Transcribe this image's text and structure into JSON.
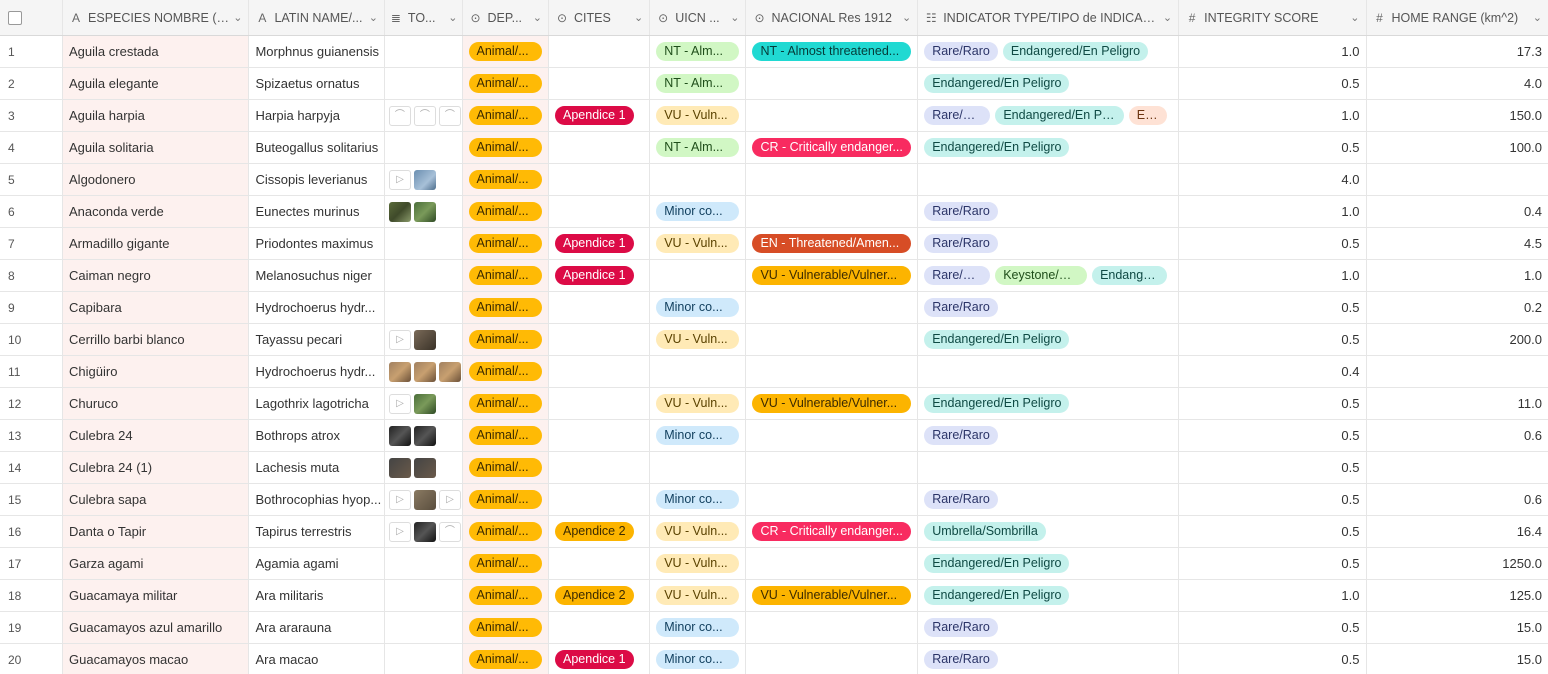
{
  "columns": [
    {
      "key": "name",
      "label": "ESPECIES NOMBRE (ES)",
      "icon": "A"
    },
    {
      "key": "latin",
      "label": "LATIN NAME/...",
      "icon": "A"
    },
    {
      "key": "to",
      "label": "TO...",
      "icon": "≣"
    },
    {
      "key": "dep",
      "label": "DEP...",
      "icon": "⊙"
    },
    {
      "key": "cites",
      "label": "CITES",
      "icon": "⊙"
    },
    {
      "key": "uicn",
      "label": "UICN ...",
      "icon": "⊙"
    },
    {
      "key": "nac",
      "label": "NACIONAL Res 1912",
      "icon": "⊙"
    },
    {
      "key": "ind",
      "label": "INDICATOR TYPE/TIPO de INDICACI...",
      "icon": "☷"
    },
    {
      "key": "int",
      "label": "INTEGRITY SCORE",
      "icon": "#"
    },
    {
      "key": "home",
      "label": "HOME RANGE (km^2)",
      "icon": "#"
    }
  ],
  "rows": [
    {
      "n": "1",
      "name": "Aguila crestada",
      "latin": "Morphnus guianensis",
      "to": [],
      "dep": "Animal/...",
      "cites": "",
      "uicn": {
        "t": "NT - Alm...",
        "c": "green"
      },
      "nac": {
        "t": "NT - Almost threatened...",
        "c": "teal"
      },
      "ind": [
        [
          "Rare/Raro",
          "lav"
        ],
        [
          "Endangered/En Peligro",
          "mint"
        ]
      ],
      "int": "1.0",
      "home": "17.3"
    },
    {
      "n": "2",
      "name": "Aguila elegante",
      "latin": "Spizaetus ornatus",
      "to": [],
      "dep": "Animal/...",
      "cites": "",
      "uicn": {
        "t": "NT - Alm...",
        "c": "green"
      },
      "nac": null,
      "ind": [
        [
          "Endangered/En Peligro",
          "mint"
        ]
      ],
      "int": "0.5",
      "home": "4.0"
    },
    {
      "n": "3",
      "name": "Aguila harpia",
      "latin": "Harpia harpyja",
      "to": [
        "doc",
        "doc",
        "doc"
      ],
      "dep": "Animal/...",
      "cites": "Apendice 1",
      "uicn": {
        "t": "VU - Vuln...",
        "c": "yellowl"
      },
      "nac": null,
      "ind": [
        [
          "Rare/Raro",
          "lav"
        ],
        [
          "Endangered/En Peligro",
          "mint"
        ],
        [
          "Emb",
          "peach"
        ]
      ],
      "int": "1.0",
      "home": "150.0"
    },
    {
      "n": "4",
      "name": "Aguila solitaria",
      "latin": "Buteogallus solitarius",
      "to": [],
      "dep": "Animal/...",
      "cites": "",
      "uicn": {
        "t": "NT - Alm...",
        "c": "green"
      },
      "nac": {
        "t": "CR - Critically endanger...",
        "c": "crimson"
      },
      "ind": [
        [
          "Endangered/En Peligro",
          "mint"
        ]
      ],
      "int": "0.5",
      "home": "100.0"
    },
    {
      "n": "5",
      "name": "Algodonero",
      "latin": "Cissopis leverianus",
      "to": [
        "play",
        "img2"
      ],
      "dep": "Animal/...",
      "cites": "",
      "uicn": null,
      "nac": null,
      "ind": [],
      "int": "4.0",
      "home": ""
    },
    {
      "n": "6",
      "name": "Anaconda verde",
      "latin": "Eunectes murinus",
      "to": [
        "img1",
        "img5"
      ],
      "dep": "Animal/...",
      "cites": "",
      "uicn": {
        "t": "Minor co...",
        "c": "blue"
      },
      "nac": null,
      "ind": [
        [
          "Rare/Raro",
          "lav"
        ]
      ],
      "int": "1.0",
      "home": "0.4"
    },
    {
      "n": "7",
      "name": "Armadillo gigante",
      "latin": "Priodontes maximus",
      "to": [],
      "dep": "Animal/...",
      "cites": "Apendice 1",
      "uicn": {
        "t": "VU - Vuln...",
        "c": "yellowl"
      },
      "nac": {
        "t": "EN - Threatened/Amen...",
        "c": "rust"
      },
      "ind": [
        [
          "Rare/Raro",
          "lav"
        ]
      ],
      "int": "0.5",
      "home": "4.5"
    },
    {
      "n": "8",
      "name": "Caiman negro",
      "latin": "Melanosuchus niger",
      "to": [],
      "dep": "Animal/...",
      "cites": "Apendice 1",
      "uicn": null,
      "nac": {
        "t": "VU - Vulnerable/Vulner...",
        "c": "amber"
      },
      "ind": [
        [
          "Rare/Raro",
          "lav"
        ],
        [
          "Keystone/Clave",
          "lime"
        ],
        [
          "Endangered",
          "mint"
        ]
      ],
      "int": "1.0",
      "home": "1.0"
    },
    {
      "n": "9",
      "name": "Capibara",
      "latin": "Hydrochoerus hydr...",
      "to": [],
      "dep": "Animal/...",
      "cites": "",
      "uicn": {
        "t": "Minor co...",
        "c": "blue"
      },
      "nac": null,
      "ind": [
        [
          "Rare/Raro",
          "lav"
        ]
      ],
      "int": "0.5",
      "home": "0.2"
    },
    {
      "n": "10",
      "name": "Cerrillo barbi blanco",
      "latin": "Tayassu pecari",
      "to": [
        "play",
        "img7"
      ],
      "dep": "Animal/...",
      "cites": "",
      "uicn": {
        "t": "VU - Vuln...",
        "c": "yellowl"
      },
      "nac": null,
      "ind": [
        [
          "Endangered/En Peligro",
          "mint"
        ]
      ],
      "int": "0.5",
      "home": "200.0"
    },
    {
      "n": "11",
      "name": "Chigüiro",
      "latin": "Hydrochoerus hydr...",
      "to": [
        "img4",
        "img4",
        "img4"
      ],
      "dep": "Animal/...",
      "cites": "",
      "uicn": null,
      "nac": null,
      "ind": [],
      "int": "0.4",
      "home": ""
    },
    {
      "n": "12",
      "name": "Churuco",
      "latin": "Lagothrix lagotricha",
      "to": [
        "play",
        "img5"
      ],
      "dep": "Animal/...",
      "cites": "",
      "uicn": {
        "t": "VU - Vuln...",
        "c": "yellowl"
      },
      "nac": {
        "t": "VU - Vulnerable/Vulner...",
        "c": "amber"
      },
      "ind": [
        [
          "Endangered/En Peligro",
          "mint"
        ]
      ],
      "int": "0.5",
      "home": "11.0"
    },
    {
      "n": "13",
      "name": "Culebra 24",
      "latin": "Bothrops atrox",
      "to": [
        "img6",
        "img6"
      ],
      "dep": "Animal/...",
      "cites": "",
      "uicn": {
        "t": "Minor co...",
        "c": "blue"
      },
      "nac": null,
      "ind": [
        [
          "Rare/Raro",
          "lav"
        ]
      ],
      "int": "0.5",
      "home": "0.6"
    },
    {
      "n": "14",
      "name": "Culebra 24 (1)",
      "latin": "Lachesis muta",
      "to": [
        "img8",
        "img8"
      ],
      "dep": "Animal/...",
      "cites": "",
      "uicn": null,
      "nac": null,
      "ind": [],
      "int": "0.5",
      "home": ""
    },
    {
      "n": "15",
      "name": "Culebra sapa",
      "latin": "Bothrocophias hyop...",
      "to": [
        "play",
        "img3",
        "play"
      ],
      "dep": "Animal/...",
      "cites": "",
      "uicn": {
        "t": "Minor co...",
        "c": "blue"
      },
      "nac": null,
      "ind": [
        [
          "Rare/Raro",
          "lav"
        ]
      ],
      "int": "0.5",
      "home": "0.6"
    },
    {
      "n": "16",
      "name": "Danta o Tapir",
      "latin": "Tapirus terrestris",
      "to": [
        "play",
        "img6",
        "doc"
      ],
      "dep": "Animal/...",
      "cites": "Apendice 2",
      "uicn": {
        "t": "VU - Vuln...",
        "c": "yellowl"
      },
      "nac": {
        "t": "CR - Critically endanger...",
        "c": "crimson"
      },
      "ind": [
        [
          "Umbrella/Sombrilla",
          "mint"
        ]
      ],
      "int": "0.5",
      "home": "16.4"
    },
    {
      "n": "17",
      "name": "Garza agami",
      "latin": "Agamia agami",
      "to": [],
      "dep": "Animal/...",
      "cites": "",
      "uicn": {
        "t": "VU - Vuln...",
        "c": "yellowl"
      },
      "nac": null,
      "ind": [
        [
          "Endangered/En Peligro",
          "mint"
        ]
      ],
      "int": "0.5",
      "home": "1250.0"
    },
    {
      "n": "18",
      "name": "Guacamaya militar",
      "latin": "Ara militaris",
      "to": [],
      "dep": "Animal/...",
      "cites": "Apendice 2",
      "uicn": {
        "t": "VU - Vuln...",
        "c": "yellowl"
      },
      "nac": {
        "t": "VU - Vulnerable/Vulner...",
        "c": "amber"
      },
      "ind": [
        [
          "Endangered/En Peligro",
          "mint"
        ]
      ],
      "int": "1.0",
      "home": "125.0"
    },
    {
      "n": "19",
      "name": "Guacamayos azul amarillo",
      "latin": "Ara ararauna",
      "to": [],
      "dep": "Animal/...",
      "cites": "",
      "uicn": {
        "t": "Minor co...",
        "c": "blue"
      },
      "nac": null,
      "ind": [
        [
          "Rare/Raro",
          "lav"
        ]
      ],
      "int": "0.5",
      "home": "15.0"
    },
    {
      "n": "20",
      "name": "Guacamayos macao",
      "latin": "Ara macao",
      "to": [],
      "dep": "Animal/...",
      "cites": "Apendice 1",
      "uicn": {
        "t": "Minor co...",
        "c": "blue"
      },
      "nac": null,
      "ind": [
        [
          "Rare/Raro",
          "lav"
        ]
      ],
      "int": "0.5",
      "home": "15.0"
    }
  ]
}
